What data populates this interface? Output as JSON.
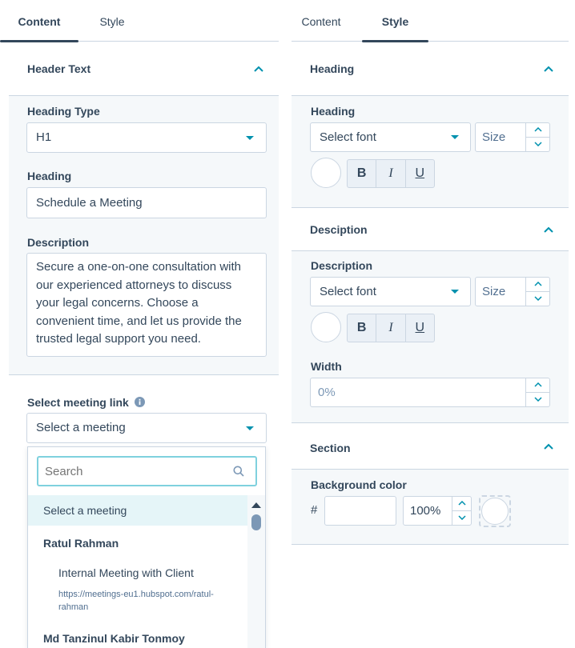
{
  "left_panel": {
    "tabs": [
      {
        "label": "Content",
        "active": true
      },
      {
        "label": "Style",
        "active": false
      }
    ],
    "header_text_section": {
      "title": "Header Text",
      "heading_type": {
        "label": "Heading Type",
        "value": "H1"
      },
      "heading": {
        "label": "Heading",
        "value": "Schedule a Meeting"
      },
      "description": {
        "label": "Description",
        "lines": [
          "Secure a one-on-one consultation with",
          "our experienced attorneys to discuss",
          "your legal concerns. Choose a",
          "convenient time, and let us provide the",
          "trusted legal support you need."
        ]
      }
    },
    "meeting_link": {
      "label": "Select meeting link",
      "value": "Select a meeting",
      "search_placeholder": "Search",
      "options": [
        {
          "type": "option",
          "label": "Select a meeting",
          "selected": true
        },
        {
          "type": "group",
          "label": "Ratul Rahman"
        },
        {
          "type": "meeting",
          "label": "Internal Meeting with Client",
          "url_line1": "https://meetings-eu1.hubspot.com/ratul-",
          "url_line2": "rahman"
        },
        {
          "type": "group",
          "label": "Md Tanzinul Kabir Tonmoy"
        }
      ]
    }
  },
  "right_panel": {
    "tabs": [
      {
        "label": "Content",
        "active": false
      },
      {
        "label": "Style",
        "active": true
      }
    ],
    "heading_section": {
      "title": "Heading",
      "label": "Heading",
      "font_placeholder": "Select font",
      "size_placeholder": "Size",
      "format_buttons": [
        "B",
        "I",
        "U"
      ]
    },
    "description_section": {
      "title": "Desciption",
      "label": "Description",
      "font_placeholder": "Select font",
      "size_placeholder": "Size",
      "format_buttons": [
        "B",
        "I",
        "U"
      ],
      "width_label": "Width",
      "width_placeholder": "0%"
    },
    "section_section": {
      "title": "Section",
      "bg_label": "Background color",
      "hash": "#",
      "hex_value": "",
      "opacity": "100%"
    }
  },
  "colors": {
    "text": "#33475b",
    "accent": "#0091ae",
    "border": "#cbd6e2",
    "panel_bg": "#f5f8fa",
    "selected_option_bg": "#e5f5f8",
    "url_text": "#516f90"
  }
}
